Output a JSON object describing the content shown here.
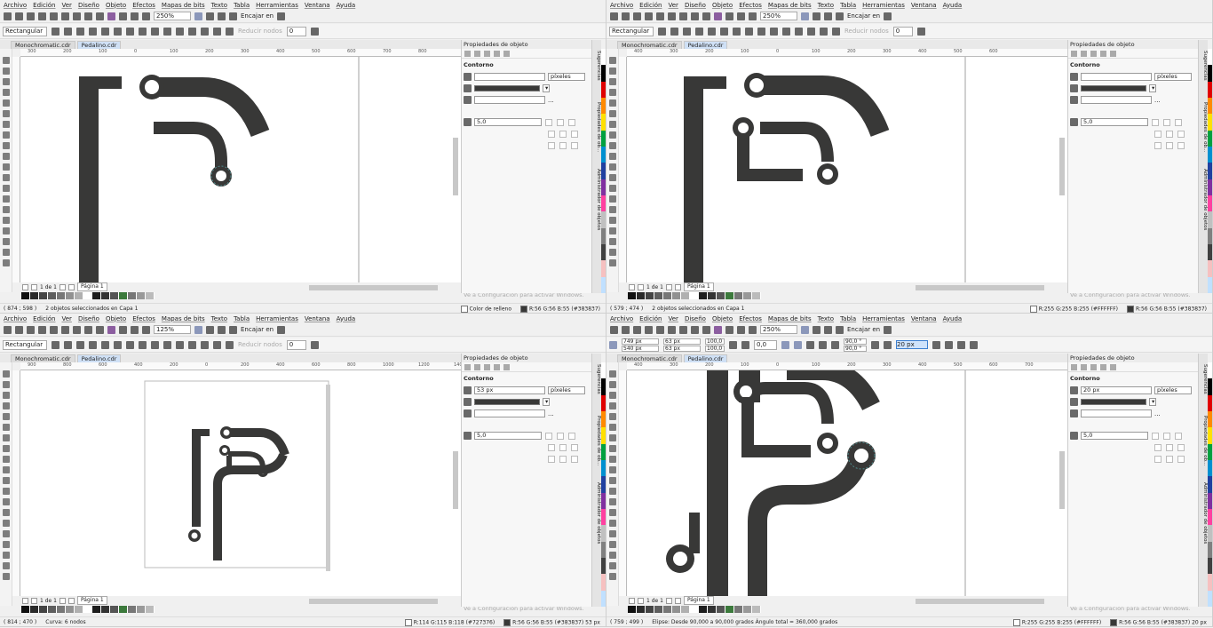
{
  "menu": [
    "Archivo",
    "Edición",
    "Ver",
    "Diseño",
    "Objeto",
    "Efectos",
    "Mapas de bits",
    "Texto",
    "Tabla",
    "Herramientas",
    "Ventana",
    "Ayuda"
  ],
  "snap_label": "Encajar en",
  "shape_mode": "Rectangular",
  "reduce_nodes": "Reducir nodos",
  "node_count": "0",
  "docs": [
    "Monochromatic.cdr",
    "Pedalino.cdr"
  ],
  "docker": {
    "title": "Propiedades de objeto",
    "section": "Contorno",
    "units": "píxeles",
    "miter": "5,0",
    "ellipsis": "...",
    "arrow": "▾"
  },
  "side_tabs": [
    "Sugerencias",
    "Propiedades de ob...",
    "Administrador de objetos"
  ],
  "page_nav": {
    "count": "1 de 1",
    "page": "Página 1"
  },
  "watermark": {
    "title": "Activar Windows",
    "sub": "Ve a Configuración para activar Windows."
  },
  "colors": {
    "ink": "#383837",
    "teal": "#4f8a8b",
    "page": "#ffffff"
  },
  "palette": [
    "#111111",
    "#2a2a2a",
    "#444444",
    "#5e5e5e",
    "#777777",
    "#919191",
    "#b0b0b0",
    "#ffffff",
    "#1e1e1e",
    "#333333",
    "#555555",
    "#3c7a3c",
    "#777777",
    "#999999",
    "#bbbbbb"
  ],
  "right_palette": [
    "#ffffff",
    "#000000",
    "#e00000",
    "#ff8a00",
    "#ffe000",
    "#00a040",
    "#0090d0",
    "#2040a0",
    "#8030a0",
    "#ff40a0",
    "#c0c0c0",
    "#808080",
    "#404040",
    "#f6c0c0",
    "#c0e0ff"
  ],
  "quadrants": [
    {
      "zoom": "250%",
      "ruler": [
        "300",
        "200",
        "100",
        "0",
        "100",
        "200",
        "300",
        "400",
        "500",
        "600",
        "700",
        "800"
      ],
      "width_value": "",
      "status_left": "( 874 ; 598 )",
      "status_mid": "2 objetos seleccionados en Capa 1",
      "status_fill": "Color de relleno",
      "status_outline": "R:56 G:56 B:55 (#383837)"
    },
    {
      "zoom": "250%",
      "ruler": [
        "400",
        "300",
        "200",
        "100",
        "0",
        "100",
        "200",
        "300",
        "400",
        "500",
        "600"
      ],
      "width_value": "",
      "status_left": "( 579 ; 474 )",
      "status_mid": "2 objetos seleccionados en Capa 1",
      "status_fill": "R:255 G:255 B:255 (#FFFFFF)",
      "status_outline": "R:56 G:56 B:55 (#383837)"
    },
    {
      "zoom": "125%",
      "ruler": [
        "900",
        "800",
        "600",
        "400",
        "200",
        "0",
        "200",
        "400",
        "600",
        "800",
        "1000",
        "1200",
        "1400"
      ],
      "width_value": "53 px",
      "status_left": "( 814 ; 470 )",
      "status_mid": "Curva: 6 nodos",
      "status_fill": "R:114 G:115 B:118 (#727376)",
      "status_outline": "R:56 G:56 B:55 (#383837)  53 px"
    },
    {
      "zoom": "250%",
      "ruler": [
        "400",
        "300",
        "200",
        "100",
        "0",
        "100",
        "200",
        "300",
        "400",
        "500",
        "600",
        "700"
      ],
      "width_value": "20 px",
      "pos_x": "749 px",
      "pos_y": "540 px",
      "size_w": "63 px",
      "size_h": "63 px",
      "scale_x": "100,0",
      "scale_y": "100,0",
      "pct": "%",
      "angle": "0,0",
      "arc_start": "90,0 °",
      "arc_end": "90,0 °",
      "outline_w": "20 px",
      "status_left": "( 759 ; 499 )",
      "status_mid": "Elipse: Desde 90,000 a 90,000 grados  Ángulo total = 360,000 grados",
      "status_fill": "R:255 G:255 B:255 (#FFFFFF)",
      "status_outline": "R:56 G:56 B:55 (#383837)  20 px"
    }
  ]
}
